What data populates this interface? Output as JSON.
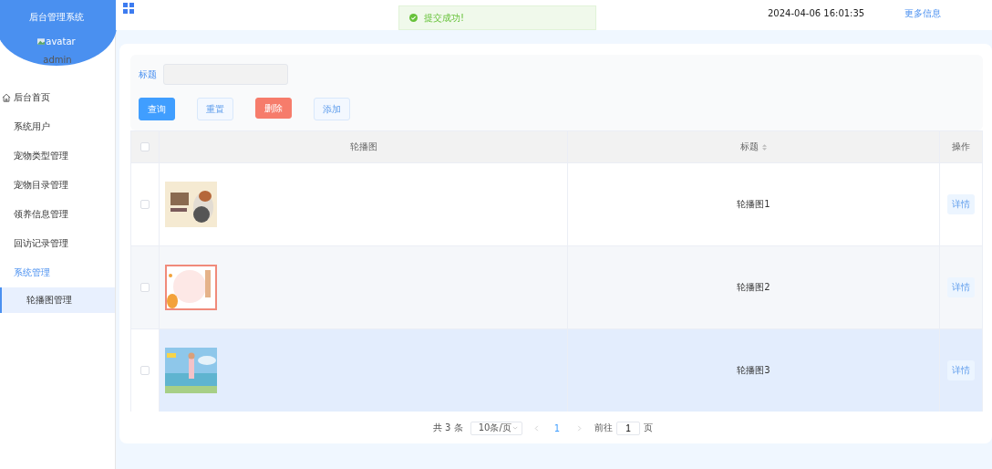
{
  "sidebar": {
    "title": "后台管理系统",
    "avatar_alt": "avatar",
    "username": "admin",
    "items": [
      {
        "label": "后台首页",
        "kind": "home",
        "selected": false
      },
      {
        "label": "系统用户",
        "kind": "plain",
        "selected": false
      },
      {
        "label": "宠物类型管理",
        "kind": "plain",
        "selected": false
      },
      {
        "label": "宠物目录管理",
        "kind": "plain",
        "selected": false
      },
      {
        "label": "领养信息管理",
        "kind": "plain",
        "selected": false
      },
      {
        "label": "回访记录管理",
        "kind": "plain",
        "selected": false
      },
      {
        "label": "系统管理",
        "kind": "plain",
        "selected": false,
        "expanded": true,
        "children": [
          {
            "label": "轮播图管理",
            "selected": true
          }
        ]
      }
    ]
  },
  "header": {
    "datetime": "2024-04-06 16:01:35",
    "more_link": "更多信息"
  },
  "toast": {
    "message": "提交成功!"
  },
  "search": {
    "label": "标题"
  },
  "buttons": [
    {
      "label": "查询",
      "kind": "primary"
    },
    {
      "label": "重置",
      "kind": "plain"
    },
    {
      "label": "删除",
      "kind": "danger"
    },
    {
      "label": "添加",
      "kind": "plain"
    }
  ],
  "table": {
    "select_all_checked": false,
    "columns": [
      {
        "label": "轮播图",
        "sortable": false
      },
      {
        "label": "标题",
        "sortable": true
      },
      {
        "label": "操作",
        "sortable": false
      }
    ],
    "rows": [
      {
        "title": "轮播图1",
        "action": "详情",
        "selected": false,
        "checked": false
      },
      {
        "title": "轮播图2",
        "action": "详情",
        "selected": false,
        "checked": false
      },
      {
        "title": "轮播图3",
        "action": "详情",
        "selected": true,
        "checked": false
      }
    ]
  },
  "pagination": {
    "total": "共 3 条",
    "page_size": "10条/页",
    "current": "1",
    "goto_label": "前往",
    "goto_value": "1",
    "page_unit": "页"
  }
}
